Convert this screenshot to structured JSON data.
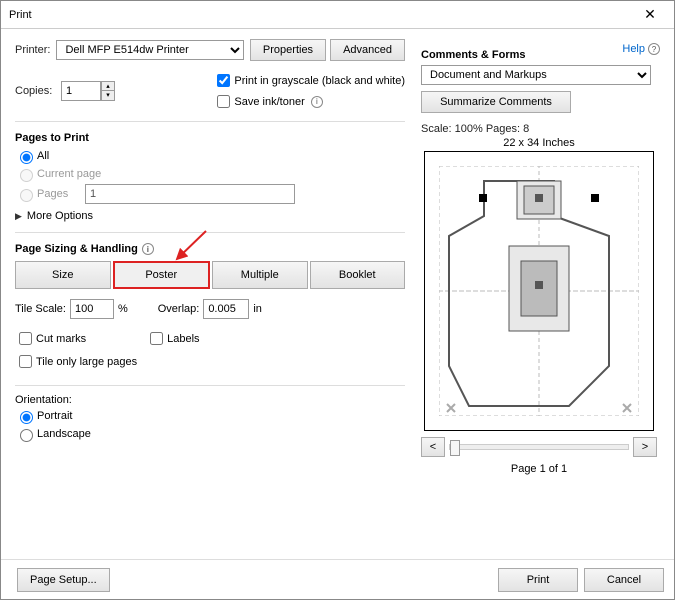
{
  "window": {
    "title": "Print",
    "close_glyph": "✕"
  },
  "top": {
    "printer_label": "Printer:",
    "printer_selected": "Dell MFP E514dw Printer",
    "properties_btn": "Properties",
    "advanced_btn": "Advanced",
    "copies_label": "Copies:",
    "copies_value": "1",
    "help_label": "Help",
    "grayscale_label": "Print in grayscale (black and white)",
    "grayscale_checked": true,
    "saveink_label": "Save ink/toner",
    "saveink_checked": false
  },
  "pages": {
    "heading": "Pages to Print",
    "all": "All",
    "current": "Current page",
    "pages_label": "Pages",
    "pages_value": "1",
    "more": "More Options"
  },
  "sizing": {
    "heading": "Page Sizing & Handling",
    "buttons": [
      "Size",
      "Poster",
      "Multiple",
      "Booklet"
    ],
    "active_index": 1,
    "tile_scale_label": "Tile Scale:",
    "tile_scale_value": "100",
    "tile_scale_suffix": "%",
    "overlap_label": "Overlap:",
    "overlap_value": "0.005",
    "overlap_suffix": "in",
    "cut_marks": "Cut marks",
    "labels": "Labels",
    "tile_large": "Tile only large pages"
  },
  "orientation": {
    "heading": "Orientation:",
    "portrait": "Portrait",
    "landscape": "Landscape"
  },
  "comments": {
    "heading": "Comments & Forms",
    "selected": "Document and Markups",
    "summarize_btn": "Summarize Comments"
  },
  "preview": {
    "scale_text": "Scale: 100% Pages: 8",
    "dim_text": "22 x 34 Inches",
    "prev": "<",
    "next": ">",
    "page_of": "Page 1 of 1"
  },
  "footer": {
    "page_setup": "Page Setup...",
    "print": "Print",
    "cancel": "Cancel"
  }
}
